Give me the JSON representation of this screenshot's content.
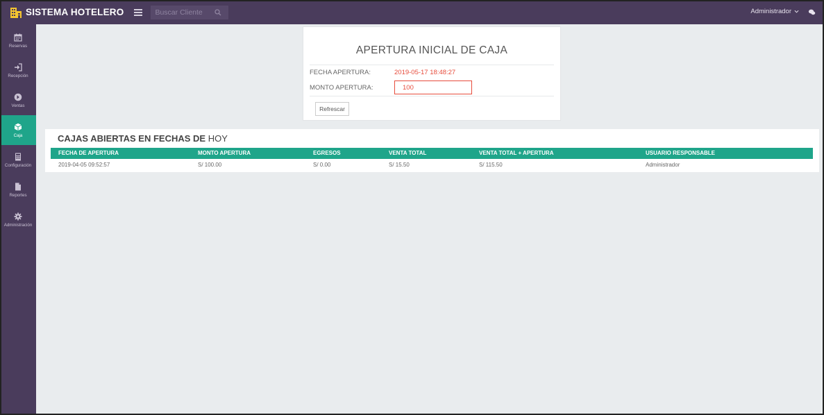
{
  "header": {
    "brand": "SISTEMA HOTELERO",
    "search_placeholder": "Buscar Cliente",
    "user": "Administrador"
  },
  "sidebar": {
    "items": [
      {
        "label": "Reservas",
        "icon": "calendar-icon",
        "active": false
      },
      {
        "label": "Recepción",
        "icon": "sign-in-icon",
        "active": false
      },
      {
        "label": "Ventas",
        "icon": "arrow-circle-right-icon",
        "active": false
      },
      {
        "label": "Caja",
        "icon": "cube-icon",
        "active": true
      },
      {
        "label": "Configuración",
        "icon": "calculator-icon",
        "active": false
      },
      {
        "label": "Reportes",
        "icon": "file-icon",
        "active": false
      },
      {
        "label": "Administración",
        "icon": "cog-icon",
        "active": false
      }
    ]
  },
  "apertura": {
    "title": "APERTURA INICIAL DE CAJA",
    "fecha_label": "FECHA APERTURA:",
    "fecha_value": "2019-05-17 18:48:27",
    "monto_label": "MONTO APERTURA:",
    "monto_value": "100",
    "refresh_button": "Refrescar"
  },
  "cajas": {
    "title_bold": "CAJAS ABIERTAS EN FECHAS DE",
    "title_rest": "HOY",
    "columns": [
      "FECHA DE APERTURA",
      "MONTO APERTURA",
      "EGRESOS",
      "VENTA TOTAL",
      "VENTA TOTAL + APERTURA",
      "USUARIO RESPONSABLE"
    ],
    "rows": [
      [
        "2019-04-05 09:52:57",
        "S/ 100.00",
        "S/ 0.00",
        "S/ 15.50",
        "S/ 115.50",
        "Administrador"
      ]
    ]
  },
  "colors": {
    "topbar": "#4a3c5c",
    "accent": "#1fa58a",
    "alert": "#e74c3c",
    "background": "#e9ecee"
  }
}
